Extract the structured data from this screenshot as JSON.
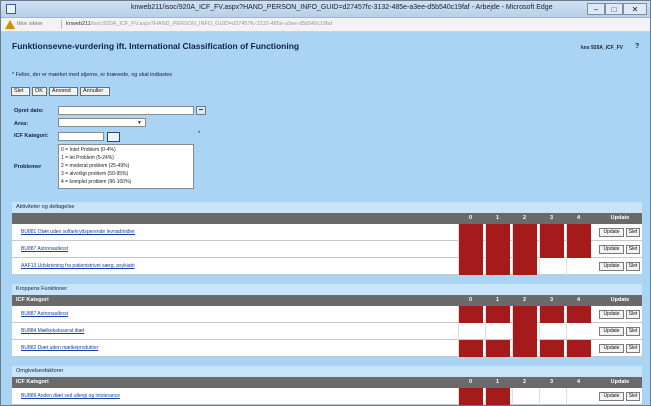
{
  "window": {
    "title": "knweb211/isoc/920A_ICF_FV.aspx?HAND_PERSON_INFO_GUID=d27457fc-3132-485e-a3ee-d5b540c19faf - Arbejde - Microsoft Edge",
    "minimize": "–",
    "maximize": "□",
    "close": "✕"
  },
  "address_bar": {
    "security_label": "Ikke sikker",
    "url_host": "knweb211",
    "url_path": "/isoc/920A_ICF_FV.aspx?HAND_PERSON_INFO_GUID=d27457fc-3132-485e-a3ee-d5b540c19faf"
  },
  "page": {
    "title": "Funktionsevne-vurdering ift. International Classification of Functioning",
    "code": "kns 920A_ICF_FV",
    "help": "?",
    "required_note": "* Felter, der er mærket med stjerne, er krævede, og skal indtastes"
  },
  "toolbar": {
    "delete": "Slet",
    "ok": "OK",
    "apply": "Anvend",
    "cancel": "Annuller"
  },
  "form": {
    "date_label": "Opret dato:",
    "area_label": "Area:",
    "icf_label": "ICF Kategori:",
    "icf_required": "*",
    "problem_label": "Problemer",
    "problem_options": [
      "0 = Intet Problem (0-4%)",
      "1 = let Problem (5-24%)",
      "2 = moderat problem (25-49%)",
      "3 = alvorligt problem (50-95%)",
      "4 = komplet problem (96-100%)"
    ]
  },
  "columns": {
    "icf": "ICF Kategori",
    "levels": [
      "0",
      "1",
      "2",
      "3",
      "4"
    ],
    "update": "Update"
  },
  "buttons": {
    "update": "Update",
    "delete": "Slet"
  },
  "colors": {
    "page_bg": "#a9d4f3",
    "filled_cell": "#a51b1b",
    "header_bg": "#6a6a6a"
  },
  "sections": [
    {
      "heading": "Aktiviteter og deltagelse",
      "show_header": false,
      "rows": [
        {
          "label": "BU881 Otæt uden solfarkrydsperende levnadmidler",
          "filled": [
            true,
            true,
            true,
            true,
            true
          ]
        },
        {
          "label": "BU887 Astronautkost",
          "filled": [
            true,
            true,
            true,
            true,
            true
          ]
        },
        {
          "label": "AAF13 Udskrivning fra patientstrivet særg, psykiatri",
          "filled": [
            true,
            true,
            true,
            false,
            false
          ]
        }
      ]
    },
    {
      "heading": "Kroppens Funktioner",
      "show_header": true,
      "rows": [
        {
          "label": "BU887 Astronautkost",
          "filled": [
            true,
            true,
            true,
            true,
            true
          ]
        },
        {
          "label": "BU884 Mælkekatuserat diæt",
          "filled": [
            false,
            false,
            true,
            false,
            false
          ]
        },
        {
          "label": "BU882 Diæt uden mælkeprodukter",
          "filled": [
            true,
            true,
            true,
            true,
            true
          ]
        }
      ]
    },
    {
      "heading": "Omgivelsesfaktorer",
      "show_header": true,
      "rows": [
        {
          "label": "BU889 Anden diæt ved allergi og intolerance",
          "filled": [
            true,
            true,
            false,
            false,
            false
          ]
        }
      ]
    }
  ]
}
